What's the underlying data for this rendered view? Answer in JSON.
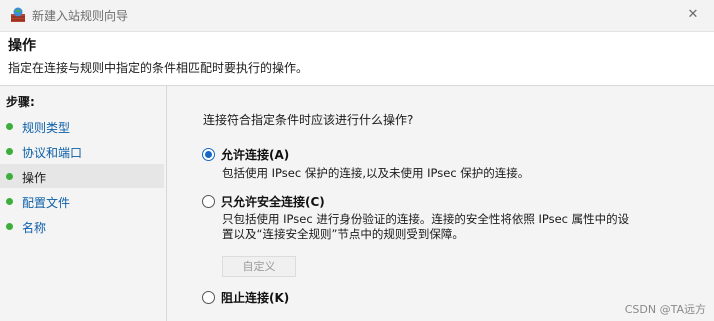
{
  "window": {
    "title": "新建入站规则向导",
    "close_icon": "✕"
  },
  "header": {
    "title": "操作",
    "description": "指定在连接与规则中指定的条件相匹配时要执行的操作。"
  },
  "sidebar": {
    "title": "步骤:",
    "items": [
      {
        "label": "规则类型",
        "active": false
      },
      {
        "label": "协议和端口",
        "active": false
      },
      {
        "label": "操作",
        "active": true
      },
      {
        "label": "配置文件",
        "active": false
      },
      {
        "label": "名称",
        "active": false
      }
    ]
  },
  "main": {
    "question": "连接符合指定条件时应该进行什么操作?",
    "options": [
      {
        "label": "允许连接(A)",
        "selected": true,
        "description": "包括使用 IPsec 保护的连接,以及未使用 IPsec 保护的连接。"
      },
      {
        "label": "只允许安全连接(C)",
        "selected": false,
        "description_line1": "只包括使用 IPsec 进行身份验证的连接。连接的安全性将依照 IPsec 属性中的设",
        "description_line2": "置以及“连接安全规则”节点中的规则受到保障。"
      },
      {
        "label": "阻止连接(K)",
        "selected": false
      }
    ],
    "custom_button": "自定义"
  },
  "watermark": "CSDN @TA远方",
  "colors": {
    "accent": "#1668c4",
    "step_dot": "#3cae3c",
    "link": "#0d5fa8"
  }
}
